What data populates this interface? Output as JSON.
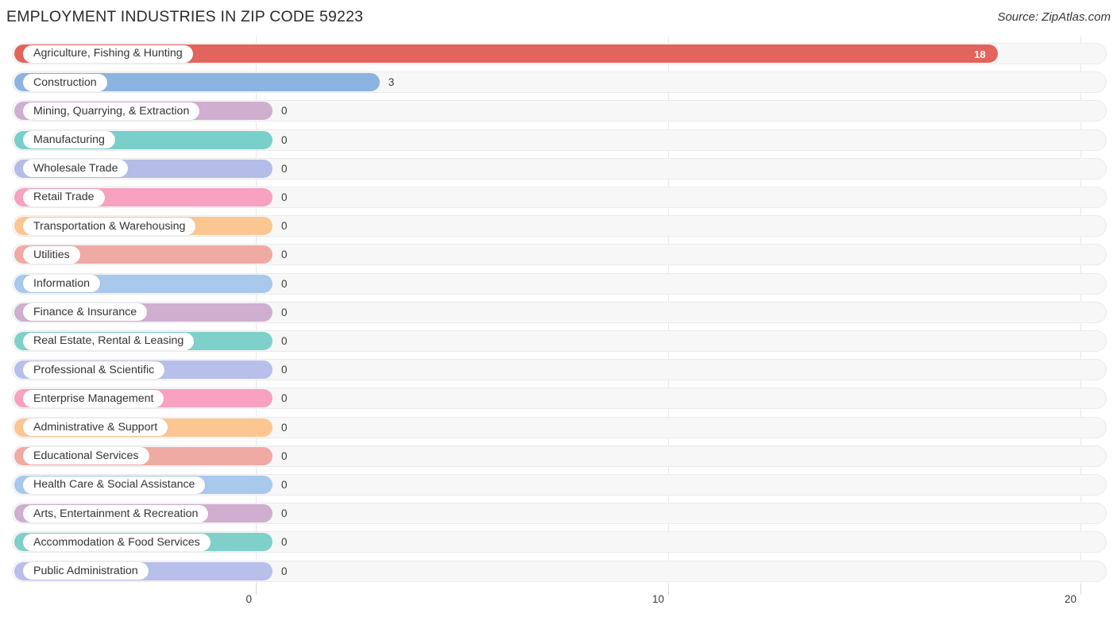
{
  "header": {
    "title": "EMPLOYMENT INDUSTRIES IN ZIP CODE 59223",
    "source": "Source: ZipAtlas.com"
  },
  "chart_data": {
    "type": "bar",
    "orientation": "horizontal",
    "title": "EMPLOYMENT INDUSTRIES IN ZIP CODE 59223",
    "xlabel": "",
    "ylabel": "",
    "xlim": [
      0,
      20
    ],
    "xticks": [
      "0",
      "10",
      "20"
    ],
    "xtick_values": [
      0,
      10,
      20
    ],
    "grid": true,
    "legend": "none",
    "categories": [
      "Agriculture, Fishing & Hunting",
      "Construction",
      "Mining, Quarrying, & Extraction",
      "Manufacturing",
      "Wholesale Trade",
      "Retail Trade",
      "Transportation & Warehousing",
      "Utilities",
      "Information",
      "Finance & Insurance",
      "Real Estate, Rental & Leasing",
      "Professional & Scientific",
      "Enterprise Management",
      "Administrative & Support",
      "Educational Services",
      "Health Care & Social Assistance",
      "Arts, Entertainment & Recreation",
      "Accommodation & Food Services",
      "Public Administration"
    ],
    "values": [
      18,
      3,
      0,
      0,
      0,
      0,
      0,
      0,
      0,
      0,
      0,
      0,
      0,
      0,
      0,
      0,
      0,
      0,
      0
    ],
    "value_labels": [
      "18",
      "3",
      "0",
      "0",
      "0",
      "0",
      "0",
      "0",
      "0",
      "0",
      "0",
      "0",
      "0",
      "0",
      "0",
      "0",
      "0",
      "0",
      "0"
    ],
    "colors": [
      "#e2645c",
      "#8cb4e2",
      "#cfaed0",
      "#79cfca",
      "#b4bce8",
      "#f8a1c0",
      "#fbc692",
      "#f0aaa4",
      "#a8c8ec",
      "#cfaed0",
      "#7fd0cb",
      "#b7bfea",
      "#f8a1c0",
      "#fbc692",
      "#f0aaa4",
      "#a8c8ec",
      "#cfaed0",
      "#7fd0cb",
      "#b7bfea"
    ]
  },
  "axis": {
    "ticks": [
      "0",
      "10",
      "20"
    ]
  }
}
